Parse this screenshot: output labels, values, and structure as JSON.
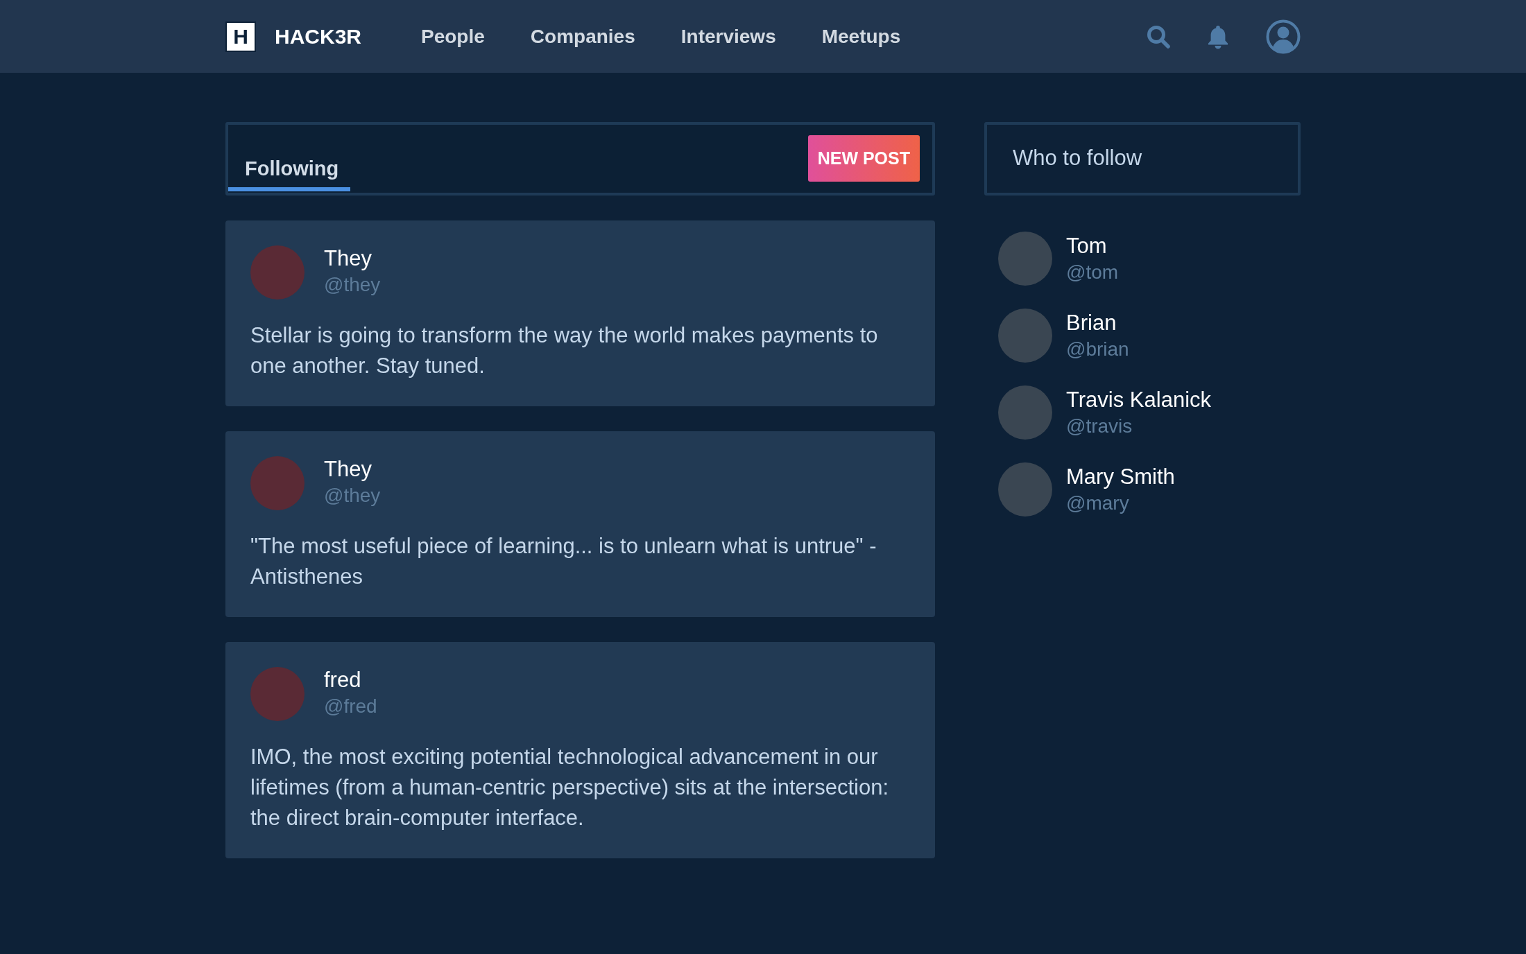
{
  "header": {
    "logo_letter": "H",
    "brand": "HACK3R",
    "nav": [
      {
        "label": "People"
      },
      {
        "label": "Companies"
      },
      {
        "label": "Interviews"
      },
      {
        "label": "Meetups"
      }
    ]
  },
  "feed": {
    "tabs": [
      {
        "label": "Following",
        "selected": true
      }
    ],
    "new_post_button": "NEW POST",
    "posts": [
      {
        "name": "They",
        "handle": "@they",
        "text": "Stellar is going to transform the way the world makes payments to one another. Stay tuned."
      },
      {
        "name": "They",
        "handle": "@they",
        "text": "\"The most useful piece of learning... is to unlearn what is untrue\" - Antisthenes"
      },
      {
        "name": "fred",
        "handle": "@fred",
        "text": "IMO, the most exciting potential technological advancement in our lifetimes (from a human-centric perspective) sits at the intersection: the direct brain-computer interface."
      }
    ]
  },
  "who_to_follow": {
    "title": "Who to follow",
    "users": [
      {
        "name": "Tom",
        "handle": "@tom"
      },
      {
        "name": "Brian",
        "handle": "@brian"
      },
      {
        "name": "Travis Kalanick",
        "handle": "@travis"
      },
      {
        "name": "Mary Smith",
        "handle": "@mary"
      }
    ]
  }
}
